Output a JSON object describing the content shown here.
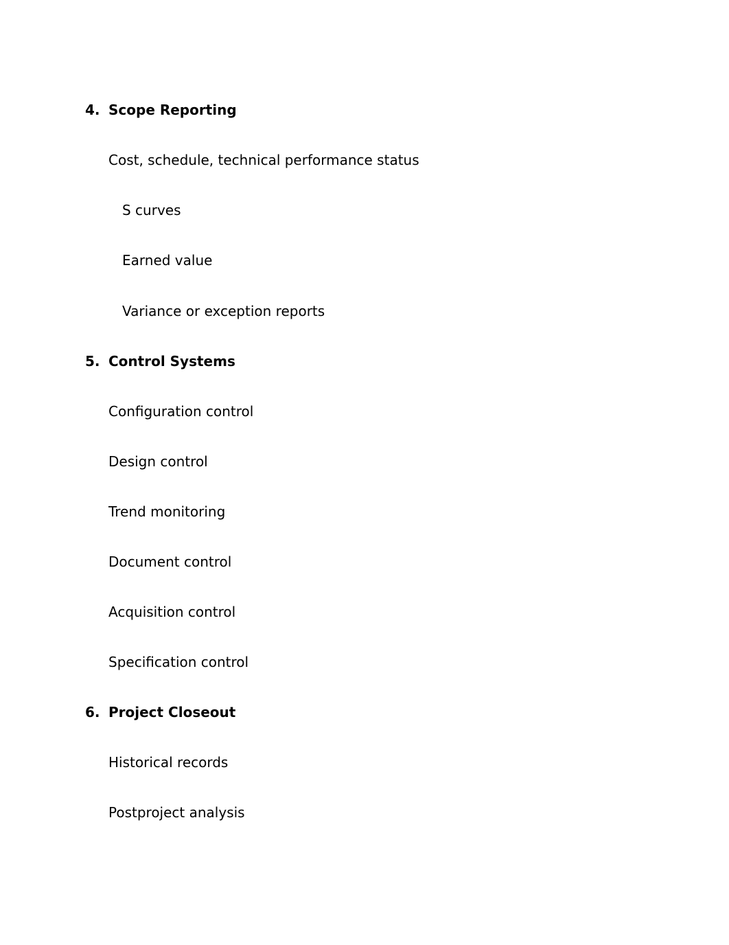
{
  "sections": [
    {
      "number": "4.",
      "title": "Scope Reporting",
      "items": [
        {
          "text": "Cost, schedule, technical performance status",
          "subitems": [
            "S curves",
            "Earned value",
            "Variance or exception reports"
          ]
        }
      ]
    },
    {
      "number": "5.",
      "title": "Control Systems",
      "items": [
        {
          "text": "Configuration control"
        },
        {
          "text": "Design control"
        },
        {
          "text": "Trend monitoring"
        },
        {
          "text": "Document control"
        },
        {
          "text": "Acquisition control"
        },
        {
          "text": "Specification control"
        }
      ]
    },
    {
      "number": "6.",
      "title": "Project Closeout",
      "items": [
        {
          "text": "Historical records"
        },
        {
          "text": "Postproject analysis"
        }
      ]
    }
  ]
}
